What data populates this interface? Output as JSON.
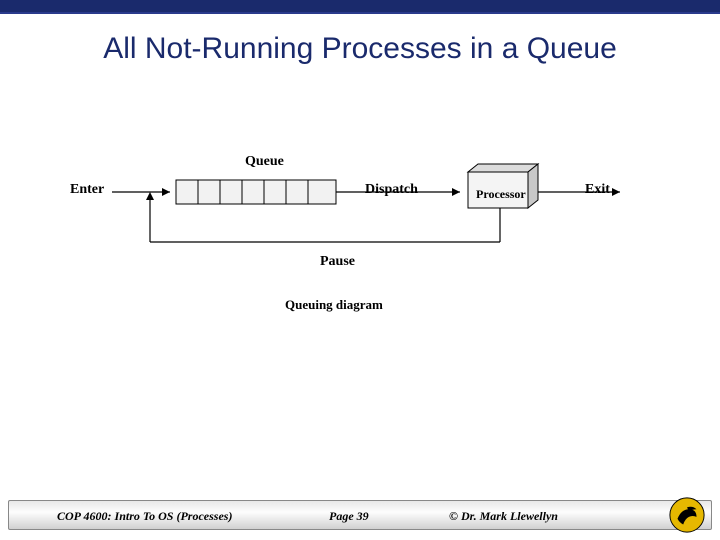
{
  "title": "All Not-Running Processes in a Queue",
  "diagram": {
    "labels": {
      "enter": "Enter",
      "queue": "Queue",
      "dispatch": "Dispatch",
      "processor": "Processor",
      "exit": "Exit",
      "pause": "Pause"
    },
    "caption": "Queuing diagram"
  },
  "footer": {
    "course": "COP 4600: Intro To OS  (Processes)",
    "page": "Page 39",
    "copyright": "© Dr. Mark Llewellyn"
  },
  "colors": {
    "navy": "#1a2a6c",
    "logo_gold": "#e6b800"
  }
}
